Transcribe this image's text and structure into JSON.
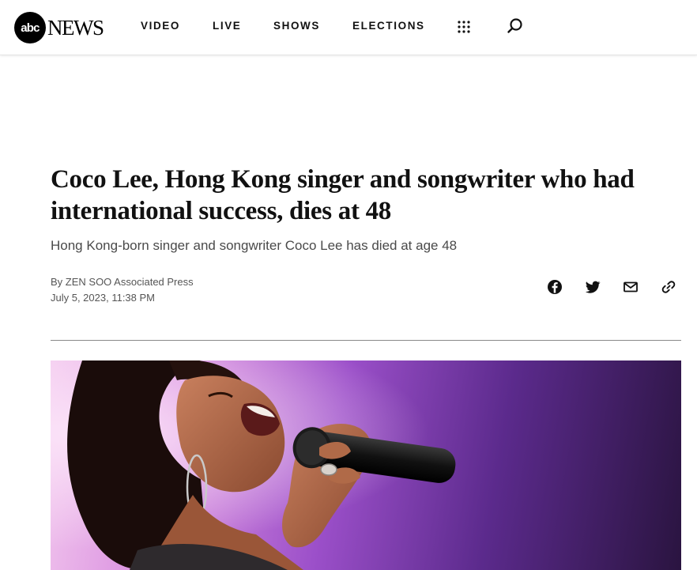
{
  "header": {
    "logo_circle": "abc",
    "logo_word": "NEWS",
    "nav": [
      {
        "label": "VIDEO"
      },
      {
        "label": "LIVE"
      },
      {
        "label": "SHOWS"
      },
      {
        "label": "ELECTIONS"
      }
    ],
    "menu_icon": "grid-dots-icon",
    "search_icon": "search-icon"
  },
  "article": {
    "headline": "Coco Lee, Hong Kong singer and songwriter who had international success, dies at 48",
    "subhead": "Hong Kong-born singer and songwriter Coco Lee has died at age 48",
    "byline": "By ZEN SOO Associated Press",
    "date": "July 5, 2023, 11:38 PM",
    "share_icons": [
      "facebook-icon",
      "twitter-icon",
      "email-icon",
      "link-icon"
    ]
  },
  "colors": {
    "photo_background": "#9b4fc9",
    "text": "#111111"
  }
}
